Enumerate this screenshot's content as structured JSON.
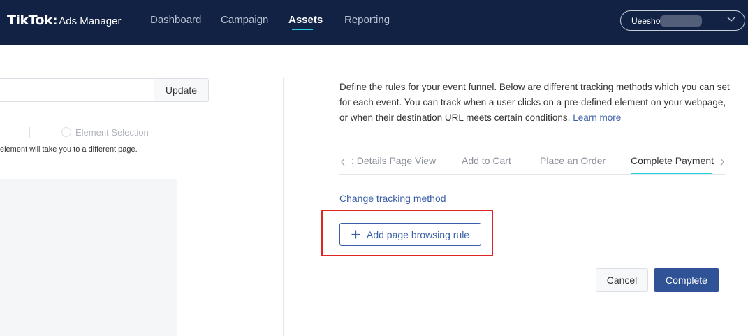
{
  "header": {
    "logo_main": "TikTok",
    "logo_sep": ":",
    "logo_sub": "Ads Manager",
    "nav": [
      {
        "label": "Dashboard",
        "active": false
      },
      {
        "label": "Campaign",
        "active": false
      },
      {
        "label": "Assets",
        "active": true
      },
      {
        "label": "Reporting",
        "active": false
      }
    ],
    "account_label": "Ueesho",
    "accent_color": "#25d0e0",
    "bar_color": "#112244"
  },
  "left_panel": {
    "update_button": "Update",
    "radio_option": "Element Selection",
    "hint": "element will take you to a different page."
  },
  "right_panel": {
    "description": "Define the rules for your event funnel. Below are different tracking methods which you can set for each event. You can track when a user clicks on a pre-defined element on your webpage, or when their destination URL meets certain conditions.",
    "learn_more": "Learn more",
    "tabs": [
      {
        "label": ": Details Page View",
        "active": false
      },
      {
        "label": "Add to Cart",
        "active": false
      },
      {
        "label": "Place an Order",
        "active": false
      },
      {
        "label": "Complete Payment",
        "active": true
      }
    ],
    "change_tracking": "Change tracking method",
    "add_rule_button": "Add page browsing rule",
    "cancel_button": "Cancel",
    "complete_button": "Complete",
    "primary_color": "#2f5396",
    "highlight_color": "#e02424"
  }
}
